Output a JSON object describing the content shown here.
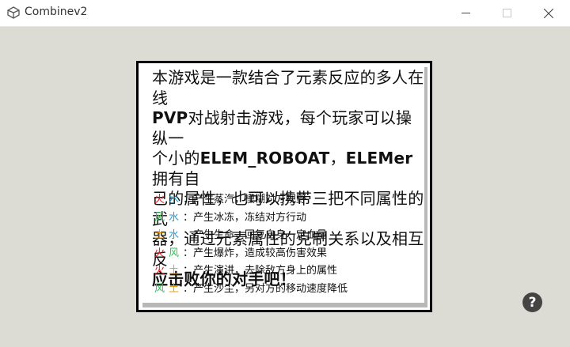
{
  "window": {
    "title": "Combinev2",
    "icon": "unity-logo-icon",
    "buttons": [
      "minimize-icon",
      "maximize-icon",
      "close-icon"
    ]
  },
  "intro": {
    "line1": "本游戏是一款结合了元素反应的多人在线",
    "line2_bold": "PVP",
    "line2_rest": "对战射击游戏，每个玩家可以操纵一",
    "line3_pre": "个小的",
    "line3_bold1": "ELEM_ROBOAT",
    "line3_mid": "，",
    "line3_bold2": "ELEMer",
    "line3_post": "拥有自",
    "line4": "己的属性，也可以携带三把不同属性的武",
    "line5": "器，通过元素属性的克制关系以及相互反",
    "line6": "应击败你的对手吧！"
  },
  "elements": {
    "fire": {
      "label": "火",
      "color": "#e8141e"
    },
    "water": {
      "label": "水",
      "color": "#1ea0dc"
    },
    "wind": {
      "label": "风",
      "color": "#28c850"
    },
    "earth": {
      "label": "土",
      "color": "#f0a000"
    }
  },
  "reactions": [
    {
      "a": "火",
      "a_color": "#e8141e",
      "b": "水",
      "b_color": "#1ea0dc",
      "text": "：产生蒸汽，模糊对方视野"
    },
    {
      "a": "风",
      "a_color": "#28c850",
      "b": "水",
      "b_color": "#1ea0dc",
      "text": "：产生冰冻，冻结对方行动"
    },
    {
      "a": "土",
      "a_color": "#f0a000",
      "b": "水",
      "b_color": "#1ea0dc",
      "text": "：产生生命，回复自身一定血量"
    },
    {
      "a": "火",
      "a_color": "#e8141e",
      "b": "风",
      "b_color": "#28c850",
      "text": "：产生爆炸，造成较高伤害效果"
    },
    {
      "a": "火",
      "a_color": "#e8141e",
      "b": "土",
      "b_color": "#f0a000",
      "text": "：产生演讲，去除敌方身上的属性"
    },
    {
      "a": "风",
      "a_color": "#28c850",
      "b": "土",
      "b_color": "#f0a000",
      "text": "：产生沙尘，另对方的移动速度降低"
    }
  ],
  "help": {
    "label": "?"
  }
}
